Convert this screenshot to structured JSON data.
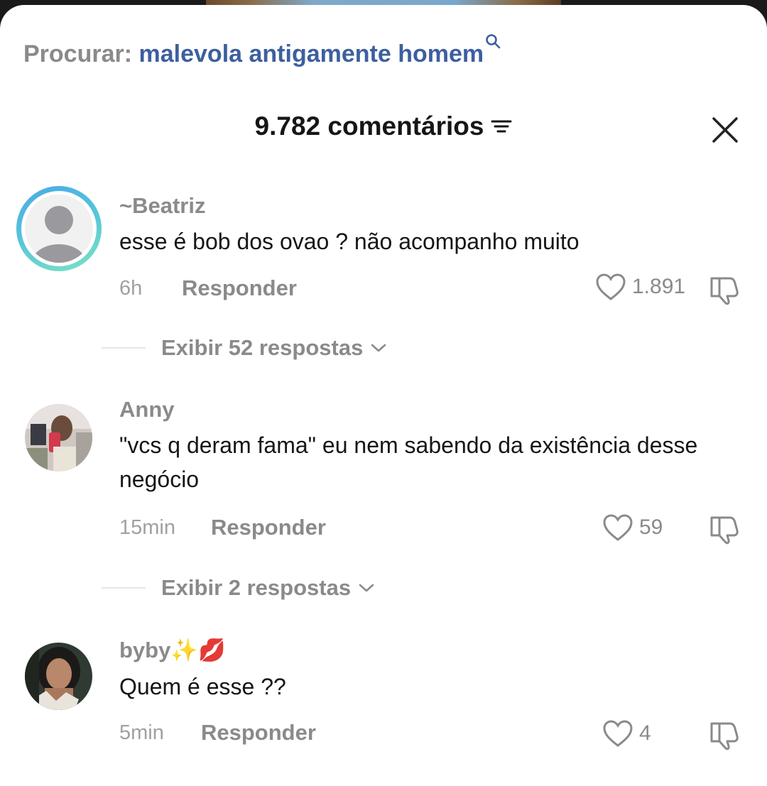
{
  "search": {
    "label": "Procurar:",
    "term": "malevola antigamente homem",
    "icon": "search-icon"
  },
  "header": {
    "title": "9.782 comentários",
    "filter_icon": "filter-icon",
    "close_icon": "close-icon"
  },
  "colors": {
    "accent_link": "#3d5fa0",
    "muted": "#8a8a8a",
    "text": "#161616",
    "ring_start": "#4aa8e8",
    "ring_end": "#7de2c4"
  },
  "comments": [
    {
      "username": "~Beatriz",
      "text": "esse é bob dos ovao ? não acompanho muito",
      "time": "6h",
      "reply_label": "Responder",
      "likes": "1.891",
      "replies_label": "Exibir 52 respostas"
    },
    {
      "username": "Anny",
      "text": "\"vcs q deram fama\" eu nem sabendo da existência desse negócio",
      "time": "15min",
      "reply_label": "Responder",
      "likes": "59",
      "replies_label": "Exibir 2 respostas"
    },
    {
      "username": "byby✨💋",
      "text": "Quem é esse ??",
      "time": "5min",
      "reply_label": "Responder",
      "likes": "4"
    }
  ]
}
